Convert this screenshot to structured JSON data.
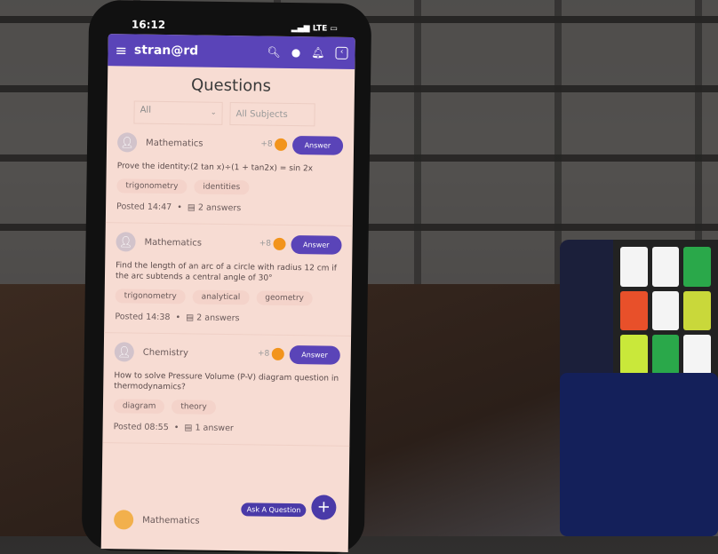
{
  "status_bar": {
    "time": "16:12",
    "network": "LTE"
  },
  "header": {
    "app_name": "stran@rd",
    "icons": [
      "menu-icon",
      "search-icon",
      "chat-icon",
      "bell-icon",
      "back-icon"
    ]
  },
  "page": {
    "title": "Questions"
  },
  "filters": {
    "type_value": "All",
    "subject_placeholder": "All Subjects"
  },
  "questions": [
    {
      "subject": "Mathematics",
      "points": "+8",
      "answer_label": "Answer",
      "text": "Prove the identity:(2 tan x)÷(1 + tan2x) = sin 2x",
      "tags": [
        "trigonometry",
        "identities"
      ],
      "posted": "Posted 14:47",
      "answers": "2 answers"
    },
    {
      "subject": "Mathematics",
      "points": "+8",
      "answer_label": "Answer",
      "text": "Find the length of an arc of a circle with radius 12 cm if the arc subtends a central angle of 30°",
      "tags": [
        "trigonometry",
        "analytical",
        "geometry"
      ],
      "posted": "Posted 14:38",
      "answers": "2 answers"
    },
    {
      "subject": "Chemistry",
      "points": "+8",
      "answer_label": "Answer",
      "text": "How to solve Pressure Volume (P-V) diagram question in thermodynamics?",
      "tags": [
        "diagram",
        "theory"
      ],
      "posted": "Posted 08:55",
      "answers": "1 answer"
    }
  ],
  "partial_question": {
    "subject": "Mathematics"
  },
  "ask_button": "Ask A Question",
  "fab": "+",
  "colors": {
    "brand": "#5a44b8",
    "coin": "#f2941c",
    "background": "#f7dcd3"
  }
}
